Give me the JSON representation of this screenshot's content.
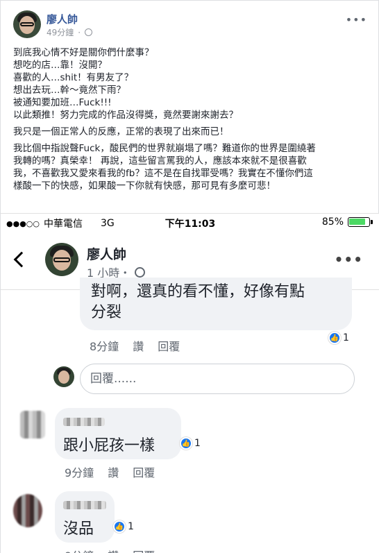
{
  "post": {
    "author": "廖人帥",
    "time": "49分鐘",
    "paragraphs": [
      [
        "到底我心情不好是關你們什麼事？",
        "想吃的店…靠！沒開？",
        "喜歡的人…shit！有男友了？",
        "想出去玩…幹～竟然下雨？",
        "被通知要加班…Fuck!!!",
        "以此類推！努力完成的作品沒得獎，竟然要謝來謝去？"
      ],
      [
        "我只是一個正常人的反應，正常的表現了出來而已！"
      ],
      [
        "我比個中指說聲Fuck，酸民們的世界就崩塌了嗎？難道你的世界是圍繞著",
        "我轉的嗎？真榮幸！ 再說，這些留言罵我的人，應該本來就不是很喜歡",
        "我，不喜歡我又愛來看我的fb？這不是在自找罪受嗎？我實在不懂你們這",
        "樣酸一下的快感，如果酸一下你就有快感，那可見有多麼可悲！"
      ]
    ]
  },
  "phone": {
    "status": {
      "carrier": "中華電信",
      "network": "3G",
      "time": "下午11:03",
      "battery_text": "85%",
      "battery_level": 0.85
    },
    "nav": {
      "name": "廖人帥",
      "time": "1 小時・"
    },
    "comments": [
      {
        "text_lines": [
          "對啊，還真的看不懂，好像有點",
          "分裂"
        ],
        "time": "8分鐘",
        "like": "讚",
        "reply": "回覆",
        "likes": "1"
      },
      {
        "text": "跟小屁孩一樣",
        "time": "9分鐘",
        "like": "讚",
        "reply": "回覆",
        "likes": "1"
      },
      {
        "text": "沒品",
        "time": "9分鐘",
        "like": "讚",
        "reply": "回覆",
        "likes": "1"
      }
    ],
    "reply_placeholder": "回覆......"
  },
  "icons": [
    "globe-icon",
    "more-icon",
    "back-chevron-icon",
    "like-icon",
    "battery-icon",
    "signal-icon"
  ],
  "colors": {
    "author_link": "#365899",
    "like_blue": "#1877f2",
    "battery_green": "#4cd964",
    "bubble_bg": "#f0f2f5"
  }
}
